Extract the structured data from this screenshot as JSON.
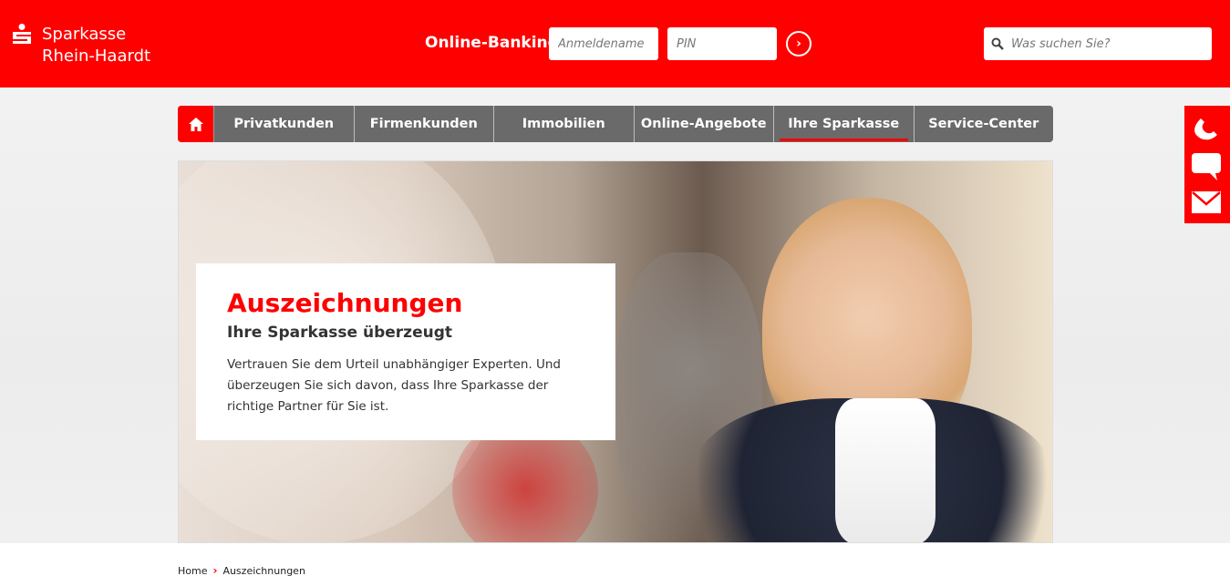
{
  "brand": {
    "name_line1": "Sparkasse",
    "name_line2": "Rhein-Haardt",
    "color": "#ff0000"
  },
  "online_banking": {
    "label": "Online-Banking",
    "username_placeholder": "Anmeldename",
    "pin_placeholder": "PIN",
    "submit_icon": "chevron-right-circle-icon"
  },
  "search": {
    "placeholder": "Was suchen Sie?",
    "icon": "search-icon"
  },
  "nav": {
    "home_icon": "home-icon",
    "items": [
      {
        "label": "Privatkunden"
      },
      {
        "label": "Firmenkunden"
      },
      {
        "label": "Immobilien"
      },
      {
        "label": "Online-Angebote"
      },
      {
        "label": "Ihre Sparkasse",
        "active": true
      },
      {
        "label": "Service-Center"
      }
    ]
  },
  "side_contact": {
    "icons": [
      "phone-icon",
      "chat-icon",
      "mail-icon"
    ]
  },
  "hero": {
    "title": "Auszeichnungen",
    "subtitle": "Ihre Sparkasse überzeugt",
    "text": "Vertrauen Sie dem Urteil unabhängiger Experten. Und überzeugen Sie sich davon, dass Ihre Sparkasse der richtige Partner für Sie ist."
  },
  "breadcrumb": {
    "home": "Home",
    "current": "Auszeichnungen"
  }
}
